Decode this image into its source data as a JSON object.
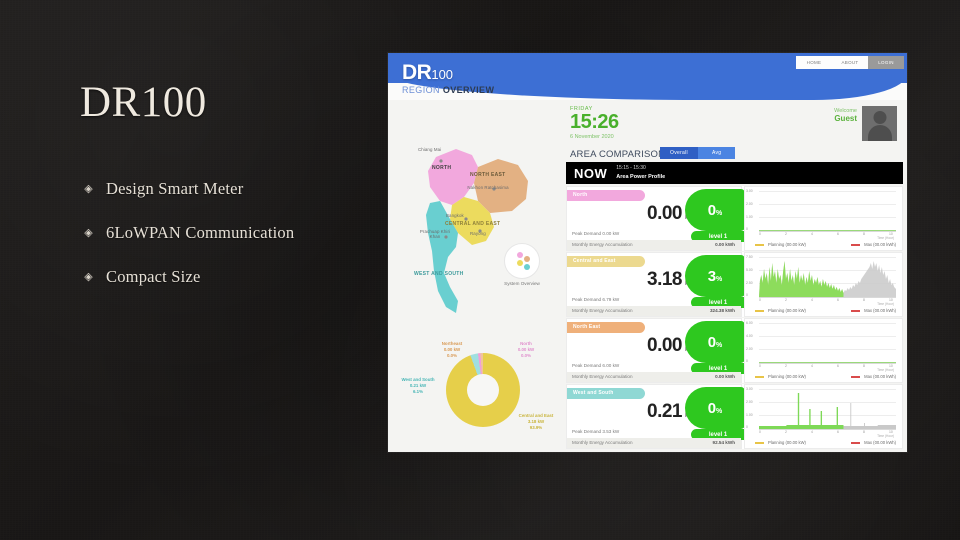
{
  "slide": {
    "title": "DR100",
    "bullet_marker": "◈",
    "bullets": [
      {
        "text": "Design Smart Meter"
      },
      {
        "text": "6LoWPAN Communication"
      },
      {
        "text": "Compact Size"
      }
    ],
    "background_color": "#1c1a19",
    "text_color": "#e6e0d6"
  },
  "dashboard": {
    "logo": {
      "main": "DR",
      "small": "100"
    },
    "nav": [
      {
        "label": "HOME",
        "active": false
      },
      {
        "label": "ABOUT",
        "active": false
      },
      {
        "label": "LOGIN",
        "active": true
      }
    ],
    "region_header": {
      "part1": "REGION ",
      "part2": "OVERVIEW"
    },
    "clock": {
      "day": "FRIDAY",
      "time": "15:26",
      "date": "6 November 2020"
    },
    "comparison": {
      "title": "AREA COMPARISON",
      "tabs": [
        {
          "label": "Overall",
          "active": true
        },
        {
          "label": "Avg",
          "active": false
        }
      ]
    },
    "user": {
      "greeting": "Welcome",
      "name": "Guest",
      "avatar_icon": "user-avatar-icon"
    },
    "nowbar": {
      "label": "NOW",
      "range": "15:15 - 15:30",
      "caption": "Area Power Profile"
    },
    "map": {
      "regions": [
        {
          "name": "NORTH",
          "color": "#f2a8dd"
        },
        {
          "name": "NORTH EAST",
          "color": "#e3b183"
        },
        {
          "name": "CENTRAL AND EAST",
          "color": "#ecdb5e"
        },
        {
          "name": "WEST AND SOUTH",
          "color": "#69cfd0"
        }
      ],
      "cities": [
        {
          "name": "Chiang Mai"
        },
        {
          "name": "Nakhon Ratchasima"
        },
        {
          "name": "Bangkok"
        },
        {
          "name": "Prachuap Khiri Khan"
        },
        {
          "name": "Rayong"
        }
      ],
      "system_overview_label": "System Overview"
    },
    "donut": {
      "slices": [
        {
          "name": "North",
          "value": "0.00 kW",
          "percent": "0.0%",
          "color": "#f2a8dd"
        },
        {
          "name": "Northeast",
          "value": "0.00 kW",
          "percent": "0.0%",
          "color": "#e3b183"
        },
        {
          "name": "Central and East",
          "value": "3.18 kW",
          "percent": "93.9%",
          "color": "#e6cf4a"
        },
        {
          "name": "West and South",
          "value": "0.21 kW",
          "percent": "6.1%",
          "color": "#69cfd0"
        }
      ]
    },
    "rows": [
      {
        "name": "North",
        "header_color": "#f2a8dd",
        "value": "0.00",
        "unit": "kW",
        "percent": "0",
        "percent_symbol": "%",
        "level": "level 1",
        "peak_label": "Peak Demand 0.00 kW",
        "monthly_label": "Monthly Energy Accumulation",
        "monthly_value": "0.00 kWh",
        "chart": {
          "y_ticks": [
            "3.00",
            "2.00",
            "1.00",
            "0"
          ],
          "x_ticks": [
            "0",
            "2",
            "4",
            "6",
            "8",
            "10",
            "12",
            "14",
            "16",
            "18",
            "20",
            "22"
          ],
          "x_caption": "Time (Hour)",
          "legend": [
            {
              "label": "Planning (00.00 kW)",
              "color": "#e8c447"
            },
            {
              "label": "Max (00.00 kWh)",
              "color": "#d94c4c"
            }
          ],
          "series_past": [
            0,
            0,
            0,
            0,
            0,
            0,
            0,
            0,
            0,
            0,
            0,
            0,
            0,
            0,
            0,
            0,
            0,
            0,
            0,
            0,
            0,
            0,
            0,
            0
          ],
          "series_future": [
            0,
            0,
            0,
            0,
            0,
            0,
            0,
            0,
            0,
            0,
            0,
            0,
            0,
            0,
            0,
            0,
            0,
            0,
            0,
            0,
            0,
            0,
            0,
            0
          ]
        }
      },
      {
        "name": "Central and East",
        "header_color": "#ecd98f",
        "value": "3.18",
        "unit": "kW",
        "percent": "3",
        "percent_symbol": "%",
        "level": "level 1",
        "peak_label": "Peak Demand 6.79 kW",
        "monthly_label": "Monthly Energy Accumulation",
        "monthly_value": "324.38 kWh",
        "chart": {
          "y_ticks": [
            "7.50",
            "5.00",
            "2.50",
            "0"
          ],
          "x_ticks": [
            "0",
            "2",
            "4",
            "6",
            "8",
            "10",
            "12",
            "14",
            "16",
            "18",
            "20",
            "22"
          ],
          "x_caption": "Time (Hour)",
          "legend": [
            {
              "label": "Planning (00.00 kW)",
              "color": "#e8c447"
            },
            {
              "label": "Max (00.00 kWh)",
              "color": "#d94c4c"
            }
          ],
          "series_past": [
            42,
            55,
            38,
            60,
            47,
            52,
            40,
            63,
            48,
            70,
            45,
            58,
            38,
            50,
            42,
            35,
            40,
            30,
            33,
            28,
            26,
            30,
            24,
            22,
            20,
            18,
            22,
            25,
            30
          ],
          "series_future": [
            20,
            22,
            25,
            30,
            36,
            42,
            50,
            58,
            66,
            74,
            62,
            80,
            70,
            58,
            66,
            50,
            44,
            38,
            30,
            24
          ]
        }
      },
      {
        "name": "North East",
        "header_color": "#efb07a",
        "value": "0.00",
        "unit": "kW",
        "percent": "0",
        "percent_symbol": "%",
        "level": "level 1",
        "peak_label": "Peak Demand 6.00 kW",
        "monthly_label": "Monthly Energy Accumulation",
        "monthly_value": "0.00 kWh",
        "chart": {
          "y_ticks": [
            "6.00",
            "4.00",
            "2.00",
            "0"
          ],
          "x_ticks": [
            "0",
            "2",
            "4",
            "6",
            "8",
            "10",
            "12",
            "14",
            "16",
            "18",
            "20",
            "22"
          ],
          "x_caption": "Time (Hour)",
          "legend": [
            {
              "label": "Planning (00.00 kW)",
              "color": "#e8c447"
            },
            {
              "label": "Max (00.00 kWh)",
              "color": "#d94c4c"
            }
          ],
          "series_past": [
            0,
            0,
            0,
            0,
            0,
            0,
            0,
            0,
            0,
            0,
            0,
            0,
            0,
            0,
            0,
            0,
            0,
            0,
            0,
            0,
            0,
            0,
            0,
            0
          ],
          "series_future": [
            0,
            0,
            0,
            0,
            0,
            0,
            0,
            0,
            0,
            0,
            0,
            0,
            0,
            0,
            0,
            0,
            0,
            0,
            0,
            0
          ]
        }
      },
      {
        "name": "West and South",
        "header_color": "#8fd8d4",
        "value": "0.21",
        "unit": "kW",
        "percent": "0",
        "percent_symbol": "%",
        "level": "level 1",
        "peak_label": "Peak Demand 3.53 kW",
        "monthly_label": "Monthly Energy Accumulation",
        "monthly_value": "92.54 kWh",
        "chart": {
          "y_ticks": [
            "3.00",
            "2.00",
            "1.00",
            "0"
          ],
          "x_ticks": [
            "0",
            "2",
            "4",
            "6",
            "8",
            "10",
            "12",
            "14",
            "16",
            "18",
            "20",
            "22"
          ],
          "x_caption": "Time (Hour)",
          "legend": [
            {
              "label": "Planning (00.00 kW)",
              "color": "#e8c447"
            },
            {
              "label": "Max (00.00 kWh)",
              "color": "#d94c4c"
            }
          ],
          "series_past": [
            4,
            4,
            4,
            4,
            4,
            4,
            4,
            4,
            5,
            5,
            6,
            5,
            4,
            4,
            90,
            6,
            5,
            48,
            5,
            5,
            4,
            42,
            5,
            5,
            4,
            4,
            5,
            42,
            5,
            5
          ],
          "series_future": [
            4,
            4,
            4,
            28,
            4,
            4,
            4,
            5,
            4,
            4,
            4,
            6,
            4,
            4,
            4,
            5,
            4,
            4,
            4,
            4
          ]
        }
      }
    ]
  },
  "chart_data": {
    "type": "area",
    "title": "Area Power Profile",
    "xlabel": "Time (Hour)",
    "ylabel": "kW",
    "x": [
      "0",
      "2",
      "4",
      "6",
      "8",
      "10",
      "12",
      "14",
      "16",
      "18",
      "20",
      "22"
    ],
    "series": [
      {
        "name": "North",
        "current_kw": 0.0,
        "percent": 0,
        "peak_demand_kw": 0.0,
        "monthly_kwh": 0.0,
        "level": 1
      },
      {
        "name": "Central and East",
        "current_kw": 3.18,
        "percent": 3,
        "peak_demand_kw": 6.79,
        "monthly_kwh": 324.38,
        "level": 1
      },
      {
        "name": "North East",
        "current_kw": 0.0,
        "percent": 0,
        "peak_demand_kw": 6.0,
        "monthly_kwh": 0.0,
        "level": 1
      },
      {
        "name": "West and South",
        "current_kw": 0.21,
        "percent": 0,
        "peak_demand_kw": 3.53,
        "monthly_kwh": 92.54,
        "level": 1
      }
    ],
    "donut": {
      "type": "pie",
      "categories": [
        "Central and East",
        "West and South",
        "North",
        "Northeast"
      ],
      "values": [
        93.9,
        6.1,
        0.0,
        0.0
      ],
      "colors": [
        "#e6cf4a",
        "#69cfd0",
        "#f2a8dd",
        "#e3b183"
      ]
    }
  }
}
